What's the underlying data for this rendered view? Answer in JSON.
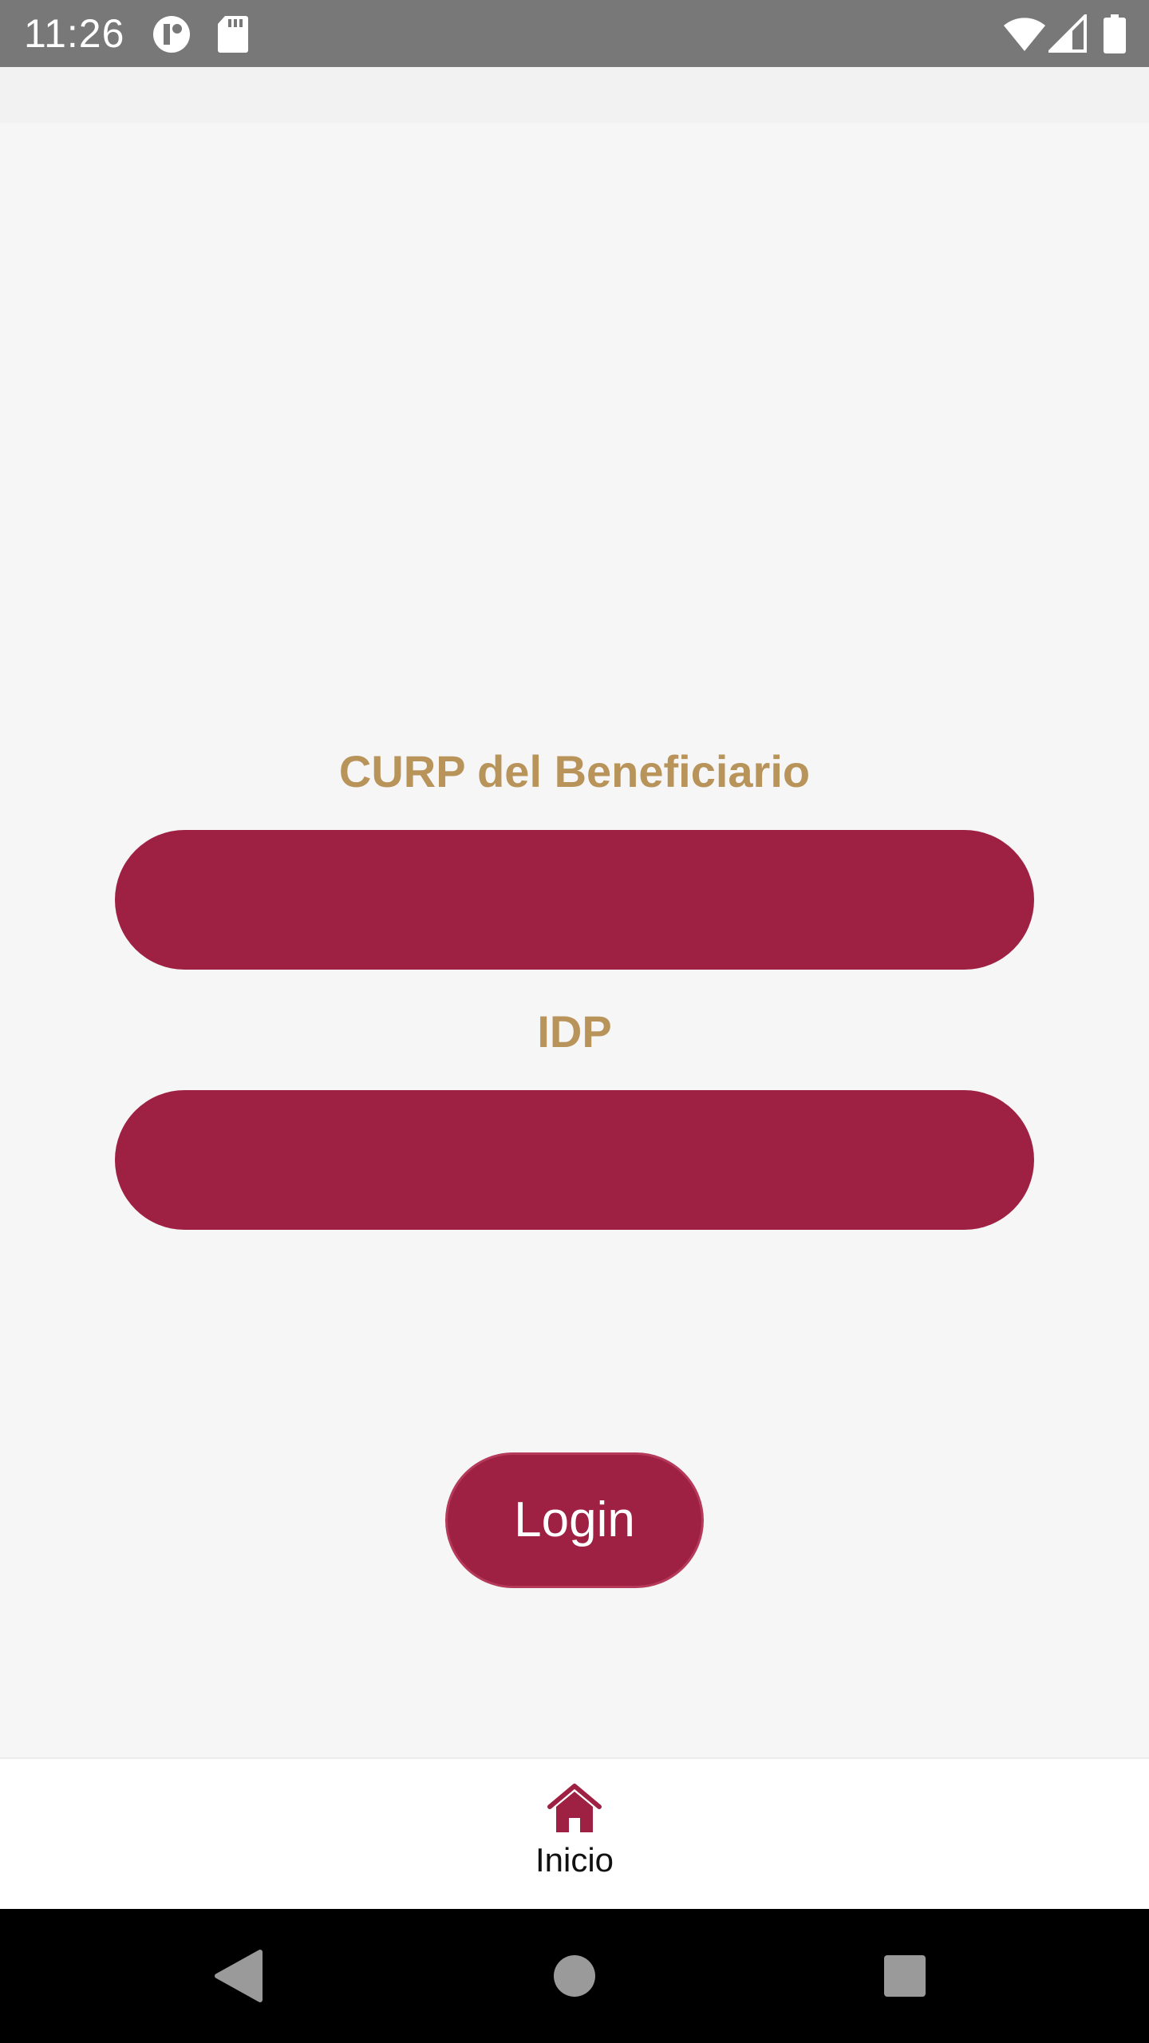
{
  "status_bar": {
    "time": "11:26",
    "icons": [
      "app-notification-icon",
      "sd-card-icon",
      "wifi-icon",
      "cell-signal-icon",
      "battery-icon"
    ]
  },
  "form": {
    "curp_label": "CURP del Beneficiario",
    "curp_value": "",
    "idp_label": "IDP",
    "idp_value": ""
  },
  "login_label": "Login",
  "bottom_nav": {
    "items": [
      {
        "label": "Inicio",
        "icon": "home-icon",
        "selected": true
      }
    ]
  },
  "system_nav": {
    "icons": [
      "back-icon",
      "home-circle-icon",
      "recents-icon"
    ]
  },
  "colors": {
    "accent": "#9e2143",
    "label_gold": "#b8945a",
    "status_bar": "#787878",
    "background": "#f6f6f6"
  }
}
